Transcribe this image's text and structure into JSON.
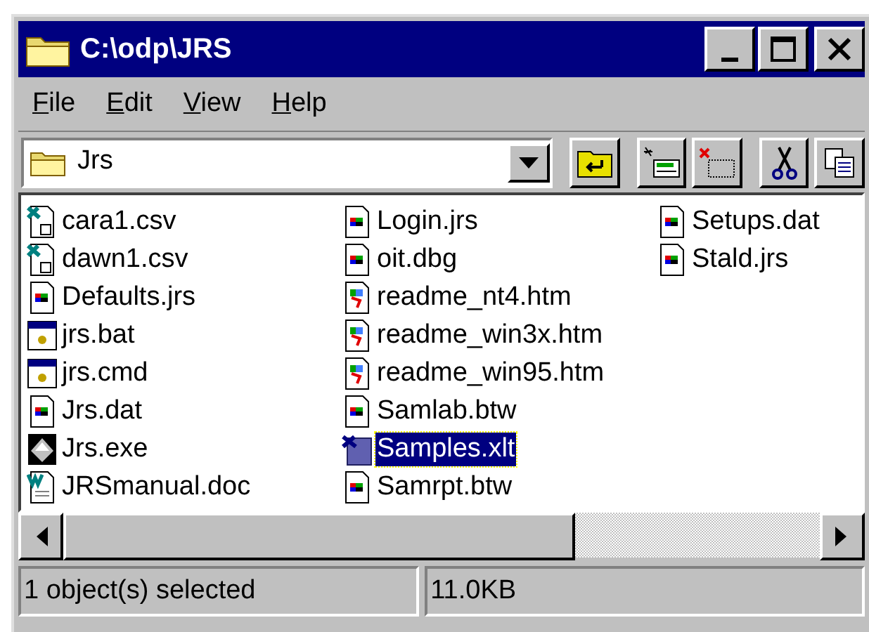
{
  "window": {
    "title": "C:\\odp\\JRS"
  },
  "menu": [
    {
      "label": "File"
    },
    {
      "label": "Edit"
    },
    {
      "label": "View"
    },
    {
      "label": "Help"
    }
  ],
  "address": {
    "value": "Jrs"
  },
  "files": [
    {
      "name": "cara1.csv",
      "kind": "csv",
      "selected": false
    },
    {
      "name": "dawn1.csv",
      "kind": "csv",
      "selected": false
    },
    {
      "name": "Defaults.jrs",
      "kind": "document",
      "selected": false
    },
    {
      "name": "jrs.bat",
      "kind": "batch",
      "selected": false
    },
    {
      "name": "jrs.cmd",
      "kind": "batch",
      "selected": false
    },
    {
      "name": "Jrs.dat",
      "kind": "document",
      "selected": false
    },
    {
      "name": "Jrs.exe",
      "kind": "exe",
      "selected": false
    },
    {
      "name": "JRSmanual.doc",
      "kind": "word",
      "selected": false
    },
    {
      "name": "Login.jrs",
      "kind": "document",
      "selected": false
    },
    {
      "name": "oit.dbg",
      "kind": "document",
      "selected": false
    },
    {
      "name": "readme_nt4.htm",
      "kind": "html",
      "selected": false
    },
    {
      "name": "readme_win3x.htm",
      "kind": "html",
      "selected": false
    },
    {
      "name": "readme_win95.htm",
      "kind": "html",
      "selected": false
    },
    {
      "name": "Samlab.btw",
      "kind": "document",
      "selected": false
    },
    {
      "name": "Samples.xlt",
      "kind": "template",
      "selected": true
    },
    {
      "name": "Samrpt.btw",
      "kind": "document",
      "selected": false
    },
    {
      "name": "Setups.dat",
      "kind": "document",
      "selected": false
    },
    {
      "name": "Stald.jrs",
      "kind": "document",
      "selected": false
    }
  ],
  "status_bar": [
    "1 object(s) selected",
    "11.0KB"
  ]
}
